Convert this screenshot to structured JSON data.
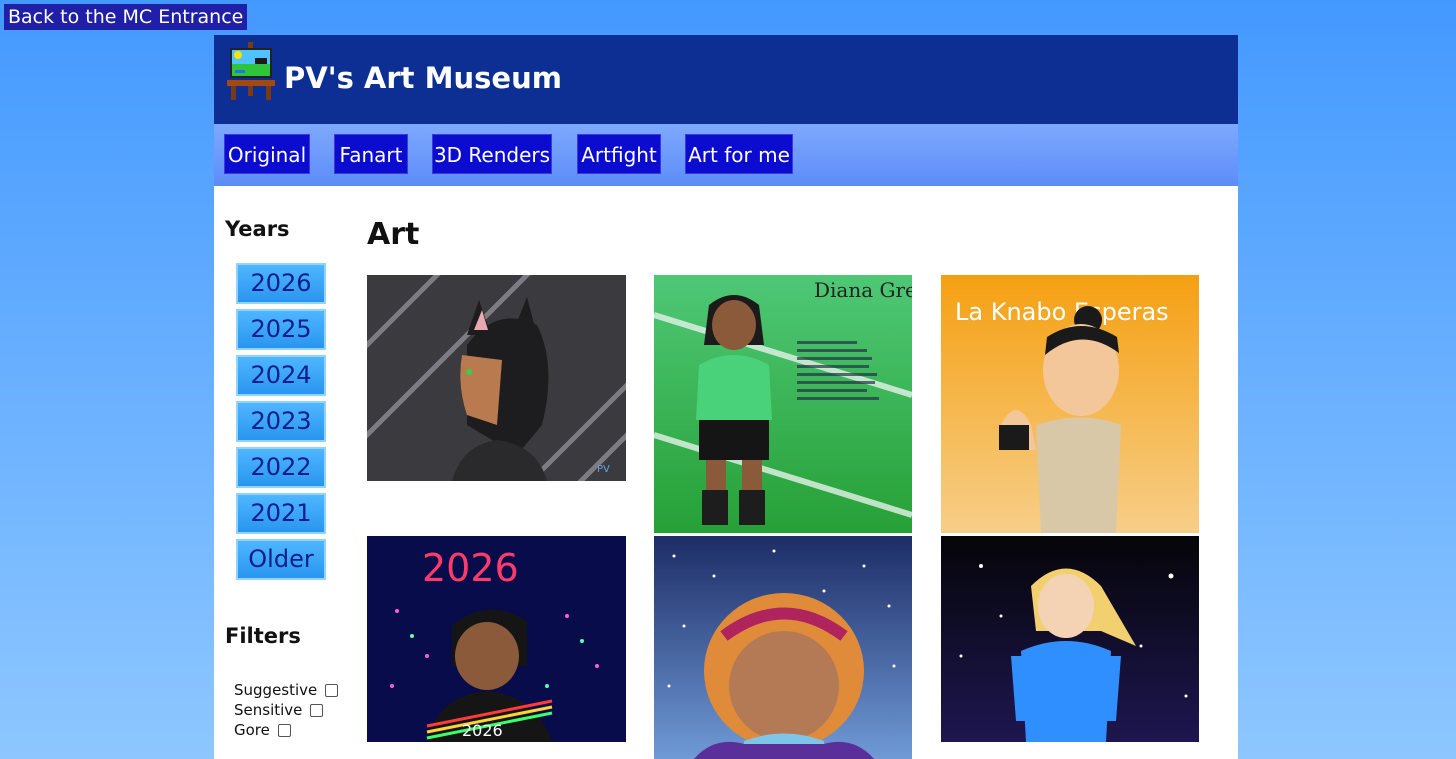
{
  "back_link": "Back to the MC Entrance",
  "header": {
    "title": "PV's Art Museum"
  },
  "nav": [
    "Original",
    "Fanart",
    "3D Renders",
    "Artfight",
    "Art for me"
  ],
  "sidebar": {
    "years_heading": "Years",
    "years": [
      "2026",
      "2025",
      "2024",
      "2023",
      "2022",
      "2021",
      "Older"
    ],
    "filters_heading": "Filters",
    "filters": [
      {
        "label": "Suggestive",
        "checked": false
      },
      {
        "label": "Sensitive",
        "checked": false
      },
      {
        "label": "Gore",
        "checked": false
      }
    ]
  },
  "main": {
    "heading": "Art"
  },
  "artworks": {
    "green": {
      "title": "Diana Green"
    },
    "orange": {
      "title": "La Knabo Esperas"
    },
    "newyear": {
      "title": "2026",
      "shirt": "2026"
    },
    "signature": "PV"
  },
  "colors": {
    "page_bg": "#4499ff",
    "header_bg": "#0d2f94",
    "nav_btn": "#0c0cd1",
    "year_btn": "#3aa6f9"
  }
}
